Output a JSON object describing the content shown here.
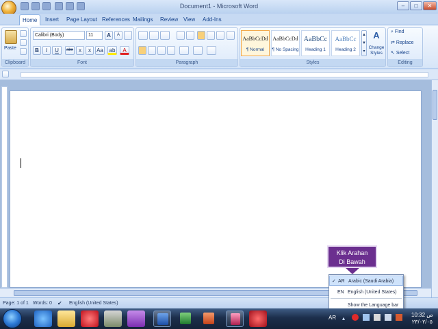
{
  "window": {
    "title": "Document1 - Microsoft Word",
    "minimize": "–",
    "maximize": "□",
    "close": "✕"
  },
  "tabs": [
    "Home",
    "Insert",
    "Page Layout",
    "References",
    "Mailings",
    "Review",
    "View",
    "Add-Ins"
  ],
  "clipboard": {
    "paste_label": "Paste",
    "group_label": "Clipboard"
  },
  "font": {
    "name": "Calibri (Body)",
    "size": "11",
    "grow": "A",
    "shrink": "A",
    "bold": "B",
    "italic": "I",
    "underline": "U",
    "strike": "abe",
    "subscript": "x",
    "superscript": "x",
    "change_case": "Aa",
    "highlight": "ab",
    "color": "A",
    "group_label": "Font"
  },
  "paragraph": {
    "group_label": "Paragraph"
  },
  "styles": {
    "items": [
      {
        "preview": "AaBbCcDd",
        "name": "¶ Normal"
      },
      {
        "preview": "AaBbCcDd",
        "name": "¶ No Spacing"
      },
      {
        "preview": "AaBbCc",
        "name": "Heading 1"
      },
      {
        "preview": "AaBbCc",
        "name": "Heading 2"
      }
    ],
    "change_styles": "Change Styles",
    "group_label": "Styles"
  },
  "editing": {
    "find": "Find",
    "replace": "Replace",
    "select": "Select",
    "group_label": "Editing"
  },
  "status": {
    "page": "Page: 1 of 1",
    "words": "Words: 0",
    "language": "English (United States)"
  },
  "language_menu": {
    "items": [
      {
        "code": "AR",
        "label": "Arabic (Saudi Arabia)",
        "checked": "✓"
      },
      {
        "code": "EN",
        "label": "English (United States)",
        "checked": ""
      }
    ],
    "show_bar": "Show the Language bar"
  },
  "callout": {
    "line1": "Klik Arahan",
    "line2": "Di Bawah"
  },
  "tray": {
    "lang": "AR",
    "time": "10:32 ص",
    "date": "٢٣/٠٢/٠٥"
  },
  "colors": {
    "callout": "#6b2f8f",
    "ribbon": "#dce9fa",
    "accent": "#15428b"
  }
}
